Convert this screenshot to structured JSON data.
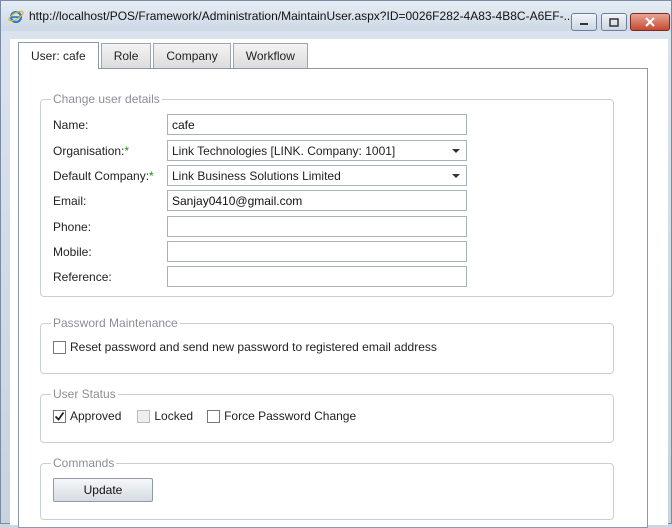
{
  "window": {
    "title": "http://localhost/POS/Framework/Administration/MaintainUser.aspx?ID=0026F282-4A83-4B8C-A6EF-..."
  },
  "tabs": [
    {
      "label": "User: cafe",
      "active": true
    },
    {
      "label": "Role"
    },
    {
      "label": "Company"
    },
    {
      "label": "Workflow"
    }
  ],
  "user_details": {
    "legend": "Change user details",
    "name_label": "Name:",
    "name_value": "cafe",
    "org_label": "Organisation:",
    "org_required": "*",
    "org_value": "Link Technologies [LINK. Company: 1001]",
    "company_label": "Default Company:",
    "company_required": "*",
    "company_value": "Link Business Solutions Limited",
    "email_label": "Email:",
    "email_value": "Sanjay0410@gmail.com",
    "phone_label": "Phone:",
    "phone_value": "",
    "mobile_label": "Mobile:",
    "mobile_value": "",
    "reference_label": "Reference:",
    "reference_value": ""
  },
  "password": {
    "legend": "Password Maintenance",
    "reset_label": "Reset password and send new password to registered email address",
    "reset_checked": false
  },
  "status": {
    "legend": "User Status",
    "approved_label": "Approved",
    "approved_checked": true,
    "locked_label": "Locked",
    "locked_checked": false,
    "force_label": "Force Password Change",
    "force_checked": false
  },
  "commands": {
    "legend": "Commands",
    "update_label": "Update"
  },
  "icons": {
    "app": "ie-icon",
    "minimize": "minimize-icon",
    "maximize": "maximize-icon",
    "close": "close-icon"
  }
}
